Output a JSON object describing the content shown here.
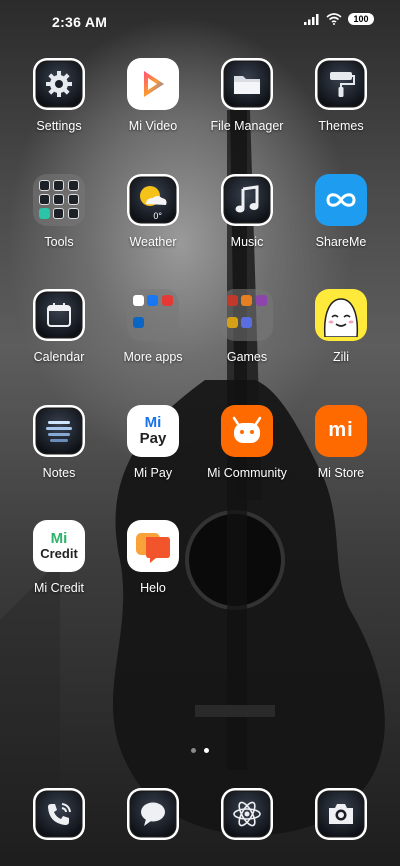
{
  "status_bar": {
    "time": "2:36 AM",
    "battery": "100"
  },
  "apps": [
    [
      {
        "label": "Settings",
        "icon": "gear-icon"
      },
      {
        "label": "Mi Video",
        "icon": "play-icon"
      },
      {
        "label": "File Manager",
        "icon": "folder-icon"
      },
      {
        "label": "Themes",
        "icon": "paint-roller-icon"
      }
    ],
    [
      {
        "label": "Tools",
        "icon": "folder-tools"
      },
      {
        "label": "Weather",
        "icon": "weather-icon",
        "temp": "0°"
      },
      {
        "label": "Music",
        "icon": "music-note-icon"
      },
      {
        "label": "ShareMe",
        "icon": "infinity-icon"
      }
    ],
    [
      {
        "label": "Calendar",
        "icon": "calendar-icon"
      },
      {
        "label": "More apps",
        "icon": "folder-more-apps"
      },
      {
        "label": "Games",
        "icon": "folder-games"
      },
      {
        "label": "Zili",
        "icon": "zili-face-icon"
      }
    ],
    [
      {
        "label": "Notes",
        "icon": "notes-icon"
      },
      {
        "label": "Mi Pay",
        "icon": "mi-pay-icon",
        "icon_text_top": "Mi",
        "icon_text_bottom": "Pay"
      },
      {
        "label": "Mi Community",
        "icon": "mi-community-icon"
      },
      {
        "label": "Mi Store",
        "icon": "mi-store-icon",
        "icon_text": "mi"
      }
    ],
    [
      {
        "label": "Mi Credit",
        "icon": "mi-credit-icon",
        "icon_text_top": "Mi",
        "icon_text_bottom": "Credit"
      },
      {
        "label": "Helo",
        "icon": "helo-icon"
      }
    ]
  ],
  "page_indicator": {
    "pages": 2,
    "active": 2
  },
  "dock": [
    {
      "name": "phone",
      "icon": "phone-icon"
    },
    {
      "name": "messages",
      "icon": "message-icon"
    },
    {
      "name": "browser",
      "icon": "atom-browser-icon"
    },
    {
      "name": "camera",
      "icon": "camera-icon"
    }
  ],
  "colors": {
    "shareme": "#1e9df0",
    "mi_orange": "#ff6a00",
    "zili_yellow": "#ffe93b",
    "mi_green": "#2db36b",
    "helo_orange": "#f57e2a",
    "weather_yellow": "#f6c21a"
  }
}
